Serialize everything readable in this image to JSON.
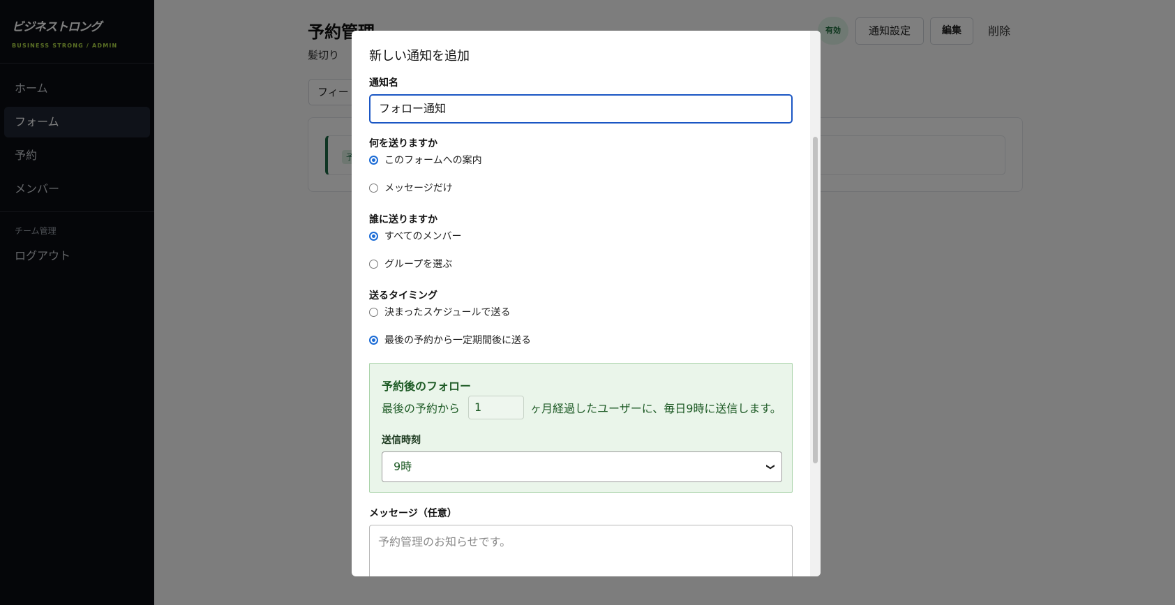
{
  "sidebar": {
    "logo": "ビジネストロング",
    "subtitle": "BUSINESS STRONG / ADMIN",
    "items": [
      {
        "label": "ホーム"
      },
      {
        "label": "フォーム"
      },
      {
        "label": "予約"
      },
      {
        "label": "メンバー"
      }
    ],
    "section": "チーム管理",
    "logout": "ログアウト"
  },
  "header": {
    "title": "予約管理",
    "subtitle": "髪切り",
    "status": "有効",
    "notify_settings": "通知設定",
    "edit": "編集",
    "delete": "削除"
  },
  "tabs": {
    "first": "フィー"
  },
  "card": {
    "tag": "予"
  },
  "modal": {
    "title": "新しい通知を追加",
    "name_label": "通知名",
    "name_value": "フォロー通知",
    "what_label": "何を送りますか",
    "what_options": [
      "このフォームへの案内",
      "メッセージだけ"
    ],
    "what_selected": 0,
    "who_label": "誰に送りますか",
    "who_options": [
      "すべてのメンバー",
      "グループを選ぶ"
    ],
    "who_selected": 0,
    "timing_label": "送るタイミング",
    "timing_options": [
      "決まったスケジュールで送る",
      "最後の予約から一定期間後に送る"
    ],
    "timing_selected": 1,
    "follow": {
      "title": "予約後のフォロー",
      "prefix": "最後の予約から",
      "months": "1",
      "suffix": "ヶ月経過したユーザーに、毎日9時に送信します。",
      "time_label": "送信時刻",
      "time_value": "9時"
    },
    "message_label": "メッセージ（任意）",
    "message_placeholder": "予約管理のお知らせです。"
  },
  "colors": {
    "sidebar_bg": "#0b0d12",
    "accent_lime": "#b6e04a",
    "primary_blue": "#1a56c4",
    "follow_green": "#1d5a25",
    "follow_bg": "#eaf5ea"
  }
}
